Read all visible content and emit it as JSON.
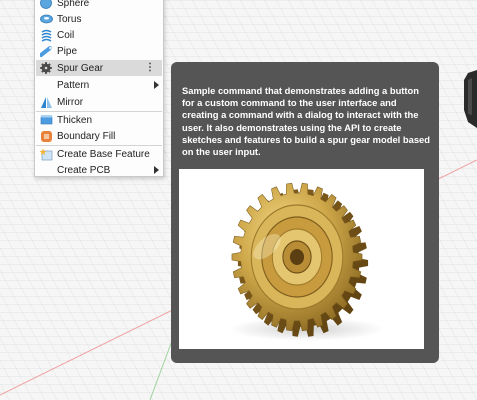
{
  "menu": {
    "items": [
      {
        "label": "Sphere",
        "icon": "sphere-icon"
      },
      {
        "label": "Torus",
        "icon": "torus-icon"
      },
      {
        "label": "Coil",
        "icon": "coil-icon"
      },
      {
        "label": "Pipe",
        "icon": "pipe-icon"
      },
      {
        "label": "Spur Gear",
        "icon": "spur-gear-icon",
        "selected": true,
        "more": "⋮"
      },
      {
        "label": "Pattern"
      },
      {
        "label": "Mirror",
        "icon": "mirror-icon"
      },
      {
        "label": "Thicken",
        "icon": "thicken-icon"
      },
      {
        "label": "Boundary Fill",
        "icon": "boundary-fill-icon"
      },
      {
        "label": "Create Base Feature",
        "icon": "create-base-feature-icon"
      },
      {
        "label": "Create PCB"
      }
    ]
  },
  "tooltip": {
    "description": "Sample command that demonstrates adding a button for a custom command to the user interface and creating a command with a dialog to interact with the user. It also demonstrates using the API to create sketches and features to build a spur gear model based on the user input.",
    "image_icon": "spur-gear-render"
  },
  "colors": {
    "canvas_bg": "#f6f6f6",
    "grid_line": "#d8d8d8",
    "axis_red": "#f0a0a0",
    "axis_green": "#9ed49e",
    "tooltip_bg": "#555555",
    "gear_gold": "#c9a443"
  }
}
